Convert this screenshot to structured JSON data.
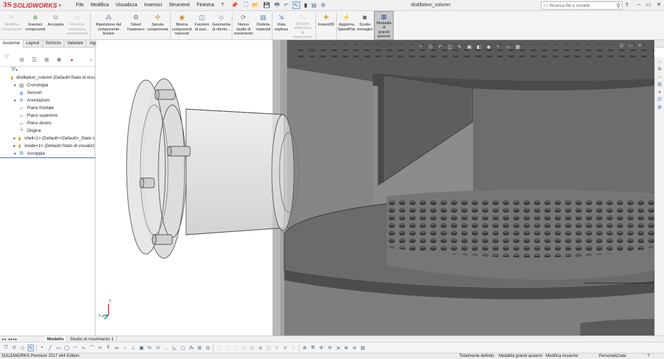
{
  "app": {
    "brand_prefix": "3S",
    "brand_name": "SOLIDWORKS",
    "document_title": "distillation_column"
  },
  "menu": [
    "File",
    "Modifica",
    "Visualizza",
    "Inserisci",
    "Strumenti",
    "Finestra",
    "?"
  ],
  "search": {
    "placeholder": "Ricerca file e modelli"
  },
  "window_controls": [
    "?",
    "–",
    "▭",
    "✕"
  ],
  "ribbon": [
    {
      "label": "Modifica componente",
      "enabled": false,
      "icon": "edit-component-icon",
      "color": "#9a9a9a"
    },
    {
      "label": "Inserisci componenti",
      "enabled": true,
      "icon": "insert-components-icon",
      "color": "#4f8f3a"
    },
    {
      "label": "Accoppia",
      "enabled": true,
      "icon": "mate-icon",
      "color": "#9a9a9a"
    },
    {
      "label": "Finestra anteprima componente",
      "enabled": false,
      "icon": "preview-window-icon",
      "color": "#9a9a9a"
    },
    {
      "label": "Ripetizione del componente lineare",
      "enabled": true,
      "icon": "linear-pattern-icon",
      "color": "#6a7fa8"
    },
    {
      "label": "Smart Fasteners",
      "enabled": true,
      "icon": "smart-fasteners-icon",
      "color": "#6b6b6b"
    },
    {
      "label": "Sposta componente",
      "enabled": true,
      "icon": "move-component-icon",
      "color": "#b9952e"
    },
    {
      "label": "Mostra componenti nascosti",
      "enabled": true,
      "icon": "show-hidden-icon",
      "color": "#c08a2b"
    },
    {
      "label": "Funzioni di assi...",
      "enabled": true,
      "icon": "assembly-features-icon",
      "color": "#4a74b0"
    },
    {
      "label": "Geometria di riferim...",
      "enabled": true,
      "icon": "reference-geometry-icon",
      "color": "#4a74b0"
    },
    {
      "label": "Nuovo studio di movimento",
      "enabled": true,
      "icon": "motion-study-icon",
      "color": "#777"
    },
    {
      "label": "Distinta materiali",
      "enabled": true,
      "icon": "bom-icon",
      "color": "#4a74b0"
    },
    {
      "label": "Vista esplosa",
      "enabled": true,
      "icon": "exploded-view-icon",
      "color": "#4a74b0"
    },
    {
      "label": "Schizzo della linea di esplosione",
      "enabled": false,
      "icon": "explode-line-icon",
      "color": "#9a9a9a"
    },
    {
      "label": "Instant3D",
      "enabled": true,
      "icon": "instant3d-icon",
      "color": "#c4a52e"
    },
    {
      "label": "Aggiorna SpeedPak",
      "enabled": true,
      "icon": "speedpak-icon",
      "color": "#4a74b0"
    },
    {
      "label": "Scatta immagini",
      "enabled": true,
      "icon": "camera-icon",
      "color": "#555"
    },
    {
      "label": "Modalità di grandi assiemi",
      "enabled": true,
      "active": true,
      "icon": "large-assembly-icon",
      "color": "#3b5fa3"
    }
  ],
  "command_tabs": [
    {
      "label": "Assieme",
      "active": true
    },
    {
      "label": "Layout"
    },
    {
      "label": "Schizzo"
    },
    {
      "label": "Valutare"
    },
    {
      "label": "Aggiunte SOLIDWORKS"
    }
  ],
  "feature_tree": [
    {
      "label": "distillation_column  (Default<Stato di visu",
      "indent": 0,
      "expander": "",
      "icon": "assembly-icon",
      "color": "#c9a227"
    },
    {
      "label": "Cronologia",
      "indent": 1,
      "expander": "▸",
      "icon": "history-icon",
      "color": "#555"
    },
    {
      "label": "Sensori",
      "indent": 1,
      "expander": "",
      "icon": "sensor-icon",
      "color": "#3a7bd5"
    },
    {
      "label": "Annotazioni",
      "indent": 1,
      "expander": "▸",
      "icon": "annotation-icon",
      "color": "#3a7bd5"
    },
    {
      "label": "Piano frontale",
      "indent": 1,
      "expander": "",
      "icon": "plane-icon",
      "color": "#777"
    },
    {
      "label": "Piano superiore",
      "indent": 1,
      "expander": "",
      "icon": "plane-icon",
      "color": "#777"
    },
    {
      "label": "Piano destro",
      "indent": 1,
      "expander": "",
      "icon": "plane-icon",
      "color": "#777"
    },
    {
      "label": "Origine",
      "indent": 1,
      "expander": "",
      "icon": "origin-icon",
      "color": "#333"
    },
    {
      "label": "shell<1> (Default<<Default>_Stato c",
      "indent": 1,
      "expander": "▸",
      "icon": "part-icon",
      "color": "#c9a227"
    },
    {
      "label": "inside<1> (Default<Stato di visualizz",
      "indent": 1,
      "expander": "▸",
      "icon": "part-icon",
      "color": "#c9a227"
    },
    {
      "label": "Accoppia",
      "indent": 1,
      "expander": "▸",
      "icon": "mates-icon",
      "color": "#4a7fc7"
    }
  ],
  "bottom_tabs": [
    {
      "label": "Modello",
      "active": true
    },
    {
      "label": "Studio di movimento 1"
    }
  ],
  "status": {
    "edition": "SOLIDWORKS Premium 2017 x64 Edition",
    "definition": "Totalmente definito",
    "mode": "Modalità grandi assiemi",
    "context": "Modifica Assieme",
    "customize": "Personalizzate"
  }
}
